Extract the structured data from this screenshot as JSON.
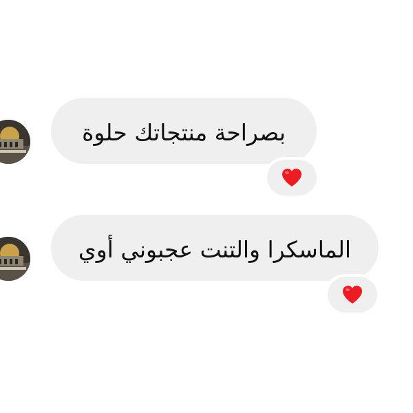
{
  "messages": [
    {
      "text": "بصراحة منتجاتك حلوة",
      "reaction_icon": "heart-icon",
      "reaction_color": "#ed1c24"
    },
    {
      "text": "الماسكرا والتنت عجبوني أوي",
      "reaction_icon": "heart-icon",
      "reaction_color": "#ed1c24"
    }
  ],
  "colors": {
    "bubble": "#efefef",
    "text": "#0f0f0f",
    "background": "#ffffff"
  }
}
